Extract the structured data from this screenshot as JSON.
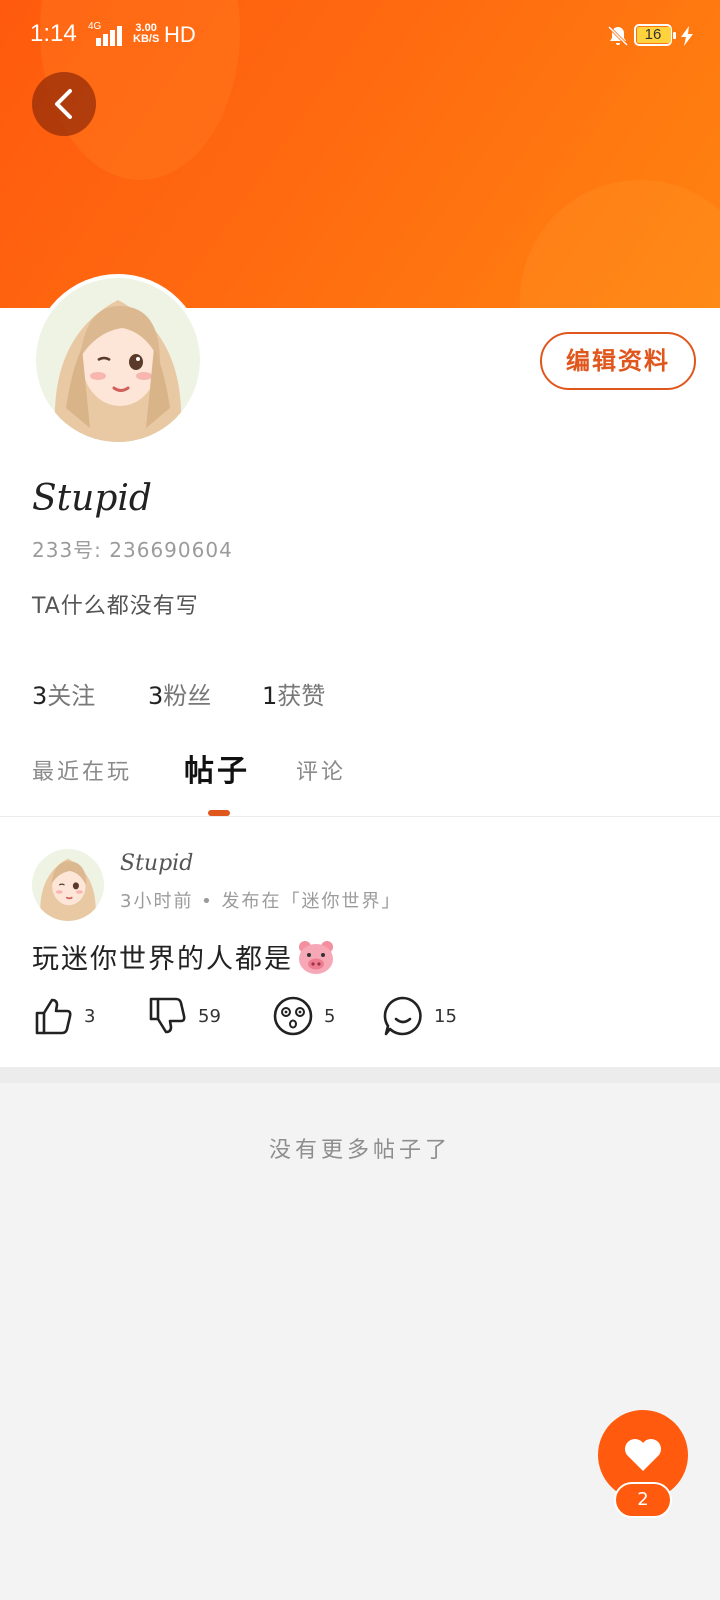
{
  "status_bar": {
    "time": "1:14",
    "network": "4G",
    "speed_value": "3.00",
    "speed_unit": "KB/S",
    "hd": "HD",
    "battery": "16"
  },
  "profile": {
    "edit_label": "编辑资料",
    "username": "Stupid",
    "id_text": "233号:  236690604",
    "bio": "TA什么都没有写",
    "stats": [
      {
        "value": "3",
        "label": "关注"
      },
      {
        "value": "3",
        "label": "粉丝"
      },
      {
        "value": "1",
        "label": "获赞"
      }
    ]
  },
  "tabs": [
    {
      "label": "最近在玩",
      "active": false
    },
    {
      "label": "帖子",
      "active": true
    },
    {
      "label": "评论",
      "active": false
    }
  ],
  "post": {
    "author": "Stupid",
    "meta": "3小时前 • 发布在「迷你世界」",
    "text": "玩迷你世界的人都是",
    "emoji": "pig-face-icon",
    "likes": "3",
    "dislikes": "59",
    "dizzy": "5",
    "comments": "15"
  },
  "footer_text": "没有更多帖子了",
  "fab": {
    "badge": "2",
    "icon": "heart-icon"
  },
  "colors": {
    "accent": "#ff5a0e",
    "accent_dark": "#e0571e",
    "header_gradient_end": "#ff8410"
  }
}
